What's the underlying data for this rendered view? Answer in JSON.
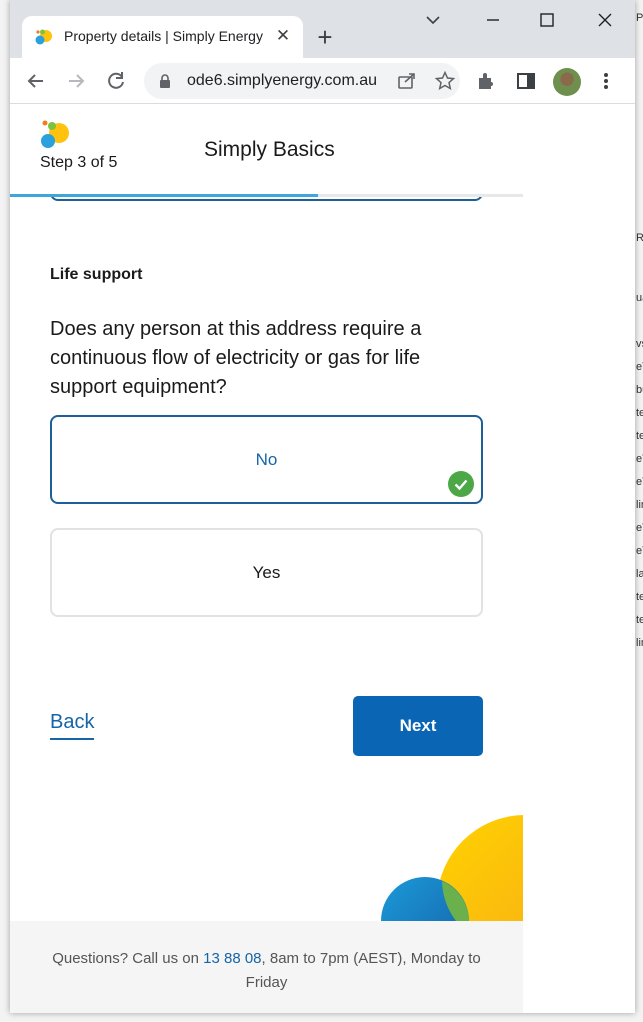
{
  "browser": {
    "tab_title": "Property details | Simply Energy",
    "tab_close": "✕",
    "new_tab": "+",
    "url": "ode6.simplyenergy.com.au",
    "controls": {
      "minimize": "—",
      "maximize": "☐",
      "close": "✕",
      "tab_search": "⌄"
    }
  },
  "header": {
    "step_text": "Step 3 of 5",
    "plan_name": "Simply Basics",
    "progress_fraction": 0.6
  },
  "section": {
    "title": "Life support",
    "question": "Does any person at this address require a continuous flow of electricity or gas for life support equipment?"
  },
  "options": [
    {
      "label": "No",
      "selected": true
    },
    {
      "label": "Yes",
      "selected": false
    }
  ],
  "actions": {
    "back_label": "Back",
    "next_label": "Next"
  },
  "footer": {
    "prefix": "Questions? Call us on",
    "phone": "13 88 08",
    "suffix": ", 8am to 7pm (AEST), Monday to Friday"
  },
  "colors": {
    "brand_blue": "#0a66b4",
    "link_blue": "#1565a8",
    "progress": "#3ea6d8",
    "check_green": "#4ca846",
    "deco_yellow": "#ffd200",
    "deco_blue": "#1a82c8",
    "deco_green": "#6ab04c"
  },
  "background_app": {
    "edge_chars": [
      "Pr",
      "R",
      "ua",
      "vs",
      "eT",
      "bu",
      "te",
      "te",
      "eT",
      "eT",
      "lin",
      "eT",
      "eT",
      "la",
      "te",
      "te",
      "lin"
    ]
  }
}
